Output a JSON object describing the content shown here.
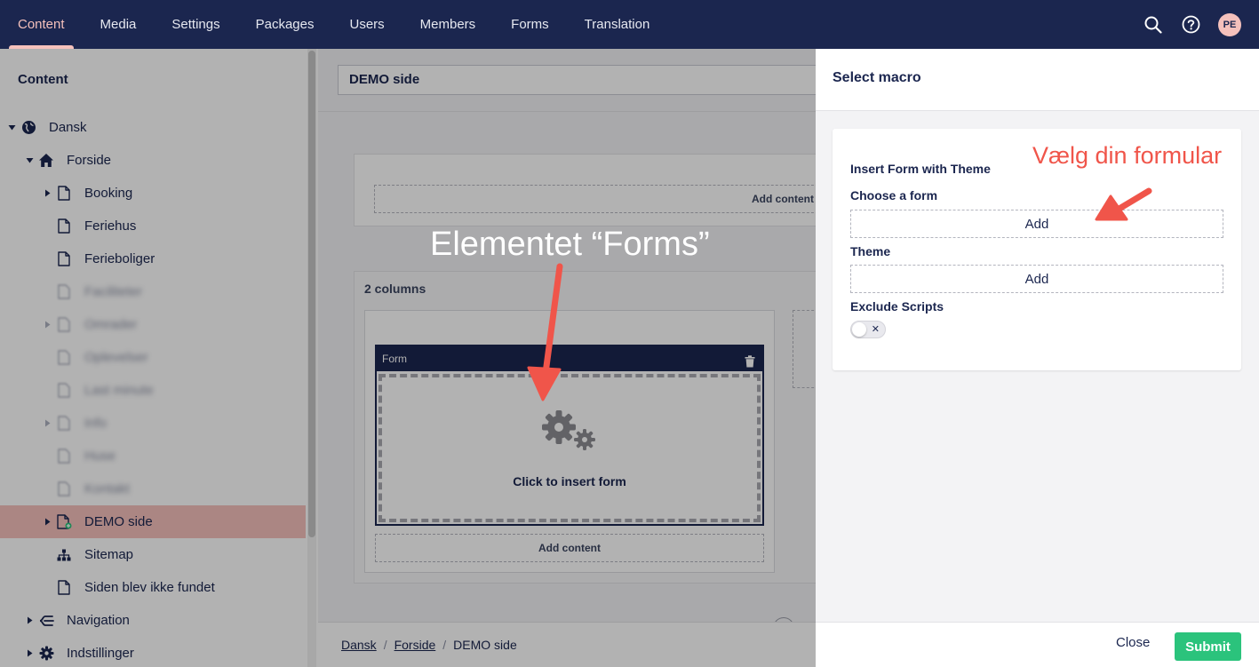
{
  "topnav": {
    "tabs": [
      {
        "label": "Content"
      },
      {
        "label": "Media"
      },
      {
        "label": "Settings"
      },
      {
        "label": "Packages"
      },
      {
        "label": "Users"
      },
      {
        "label": "Members"
      },
      {
        "label": "Forms"
      },
      {
        "label": "Translation"
      }
    ],
    "active_tab": "Content",
    "avatar_initials": "PE",
    "icons": [
      "search-icon",
      "help-icon"
    ]
  },
  "sidebar": {
    "title": "Content",
    "tree": [
      {
        "label": "Dansk",
        "icon": "globe-icon",
        "depth": 0,
        "caret": "down"
      },
      {
        "label": "Forside",
        "icon": "home-icon",
        "depth": 1,
        "caret": "down"
      },
      {
        "label": "Booking",
        "icon": "document-icon",
        "depth": 2,
        "caret": "right"
      },
      {
        "label": "Feriehus",
        "icon": "document-icon",
        "depth": 2,
        "caret": ""
      },
      {
        "label": "Ferieboliger",
        "icon": "document-icon",
        "depth": 2,
        "caret": ""
      },
      {
        "label": "Faciliteter",
        "icon": "document-icon",
        "depth": 2,
        "caret": "",
        "blurred": true
      },
      {
        "label": "Omrader",
        "icon": "document-icon",
        "depth": 2,
        "caret": "right",
        "blurred": true
      },
      {
        "label": "Oplevelser",
        "icon": "document-icon",
        "depth": 2,
        "caret": "",
        "blurred": true
      },
      {
        "label": "Last minute",
        "icon": "document-icon",
        "depth": 2,
        "caret": "",
        "blurred": true
      },
      {
        "label": "Info",
        "icon": "document-icon",
        "depth": 2,
        "caret": "right",
        "blurred": true
      },
      {
        "label": "Huse",
        "icon": "document-icon",
        "depth": 2,
        "caret": "",
        "blurred": true
      },
      {
        "label": "Kontakt",
        "icon": "document-icon",
        "depth": 2,
        "caret": "",
        "blurred": true
      },
      {
        "label": "DEMO side",
        "icon": "document-new-icon",
        "depth": 2,
        "caret": "right",
        "selected": true
      },
      {
        "label": "Sitemap",
        "icon": "sitemap-icon",
        "depth": 2,
        "caret": ""
      },
      {
        "label": "Siden blev ikke fundet",
        "icon": "document-icon",
        "depth": 2,
        "caret": ""
      },
      {
        "label": "Navigation",
        "icon": "navigation-icon",
        "depth": 1,
        "caret": "right"
      },
      {
        "label": "Indstillinger",
        "icon": "gear-icon",
        "depth": 1,
        "caret": "right"
      }
    ]
  },
  "editor": {
    "doc_name": "DEMO side",
    "add_content_label": "Add content",
    "grid_label": "2 columns",
    "form_widget_title": "Form",
    "form_placeholder": "Click to insert form",
    "breadcrumb": [
      "Dansk",
      "Forside",
      "DEMO side"
    ]
  },
  "panel": {
    "title": "Select macro",
    "macro_name": "Insert Form with Theme",
    "fields": [
      {
        "label": "Choose a form",
        "button": "Add"
      },
      {
        "label": "Theme",
        "button": "Add"
      }
    ],
    "toggle_label": "Exclude Scripts",
    "toggle_state": "off",
    "toggle_symbol": "✕",
    "close_label": "Close",
    "submit_label": "Submit"
  },
  "annotations": {
    "forms_label": "Elementet “Forms”",
    "formular_label": "Vælg din formular",
    "color": "#f0554a"
  },
  "colors": {
    "topbar": "#1b264f",
    "accent_pink": "#f5c1bc",
    "submit_green": "#2bc37c"
  }
}
